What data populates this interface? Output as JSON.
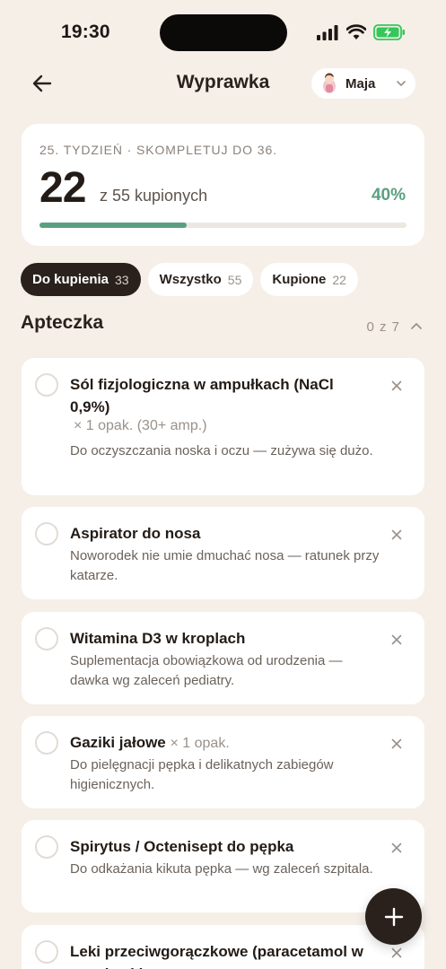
{
  "status_bar": {
    "time": "19:30",
    "battery_color": "#34c759"
  },
  "header": {
    "title": "Wyprawka",
    "profile_name": "Maja"
  },
  "summary": {
    "week_label": "25. TYDZIEŃ · SKOMPLETUJ DO 36.",
    "bought_count": "22",
    "bought_of_text": "z 55 kupionych",
    "percent_text": "40%",
    "progress_fraction": 0.4
  },
  "tabs": [
    {
      "label": "Do kupienia",
      "count": "33",
      "active": true
    },
    {
      "label": "Wszystko",
      "count": "55",
      "active": false
    },
    {
      "label": "Kupione",
      "count": "22",
      "active": false
    }
  ],
  "section": {
    "title": "Apteczka",
    "count_text": "0 z 7"
  },
  "items": [
    {
      "title": "Sól fizjologiczna w ampułkach (NaCl 0,9%)",
      "qty_line": "× 1 opak. (30+ amp.)",
      "desc": "Do oczyszczania noska i oczu — zużywa się dużo."
    },
    {
      "title": "Aspirator do nosa",
      "desc": "Noworodek nie umie dmuchać nosa — ratunek przy katarze."
    },
    {
      "title": "Witamina D3 w kroplach",
      "desc": "Suplementacja obowiązkowa od urodzenia — dawka wg zaleceń pediatry."
    },
    {
      "title": "Gaziki jałowe",
      "qty_inline": "× 1 opak.",
      "desc": "Do pielęgnacji pępka i delikatnych zabiegów higienicznych."
    },
    {
      "title": "Spirytus / Octenisept do pępka",
      "desc": "Do odkażania kikuta pępka — wg zaleceń szpitala."
    },
    {
      "title": "Leki przeciwgorączkowe (paracetamol w czopkach)"
    }
  ],
  "colors": {
    "background": "#f5efe8",
    "accent_green": "#5aa080",
    "dark": "#2a211c"
  }
}
